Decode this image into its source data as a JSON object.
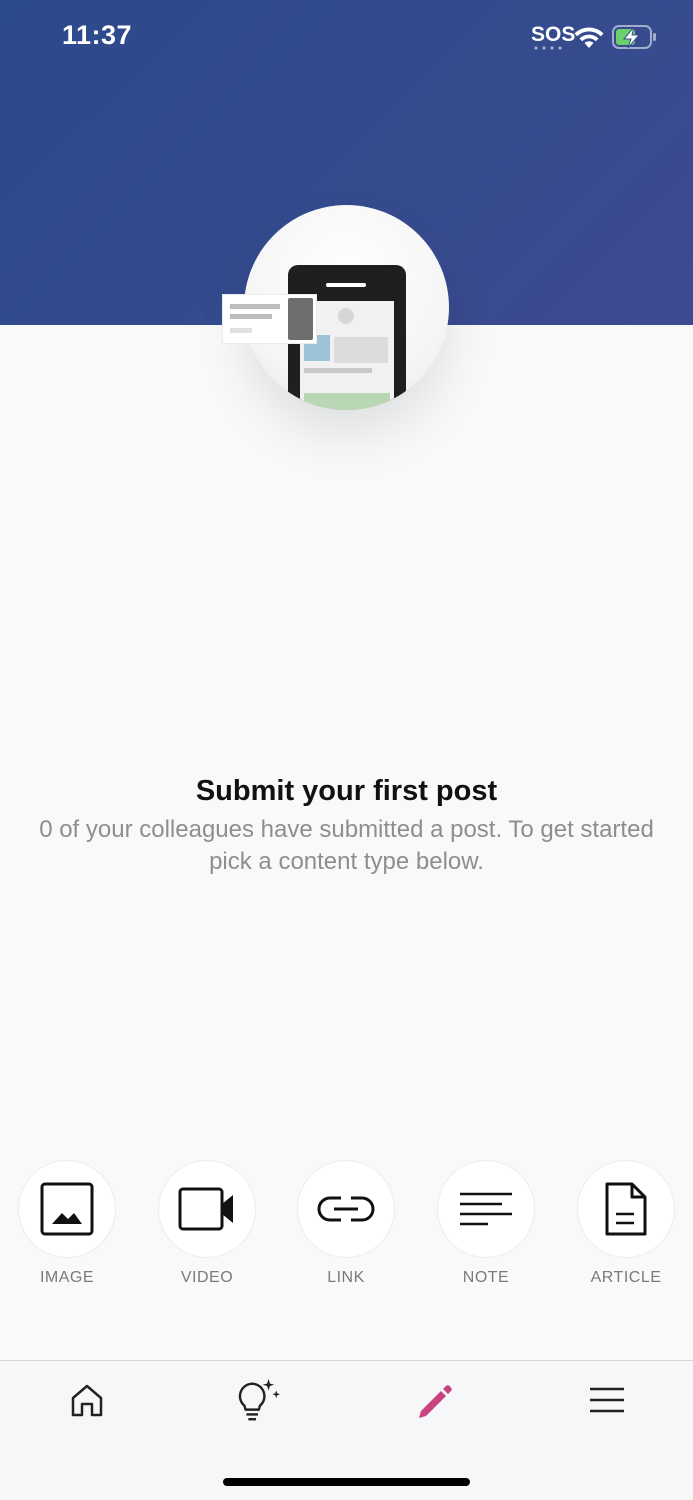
{
  "status_bar": {
    "time": "11:37",
    "sos": "SOS",
    "wifi_icon": "wifi-icon",
    "battery_icon": "battery-charging-icon"
  },
  "colors": {
    "header_gradient_start": "#2b4a8c",
    "header_gradient_end": "#3f4a92",
    "active_tab": "#c9437f",
    "background": "#f8f9f9"
  },
  "empty_state": {
    "title": "Submit your first post",
    "subtitle": "0 of your colleagues have submitted a post. To get started pick a content type below."
  },
  "content_types": [
    {
      "label": "IMAGE",
      "icon": "image-icon"
    },
    {
      "label": "VIDEO",
      "icon": "video-icon"
    },
    {
      "label": "LINK",
      "icon": "link-icon"
    },
    {
      "label": "NOTE",
      "icon": "note-icon"
    },
    {
      "label": "ARTICLE",
      "icon": "article-icon"
    }
  ],
  "tab_bar": {
    "tabs": [
      {
        "icon": "home-icon",
        "active": false
      },
      {
        "icon": "lightbulb-icon",
        "active": false
      },
      {
        "icon": "pencil-icon",
        "active": true
      },
      {
        "icon": "menu-icon",
        "active": false
      }
    ]
  }
}
